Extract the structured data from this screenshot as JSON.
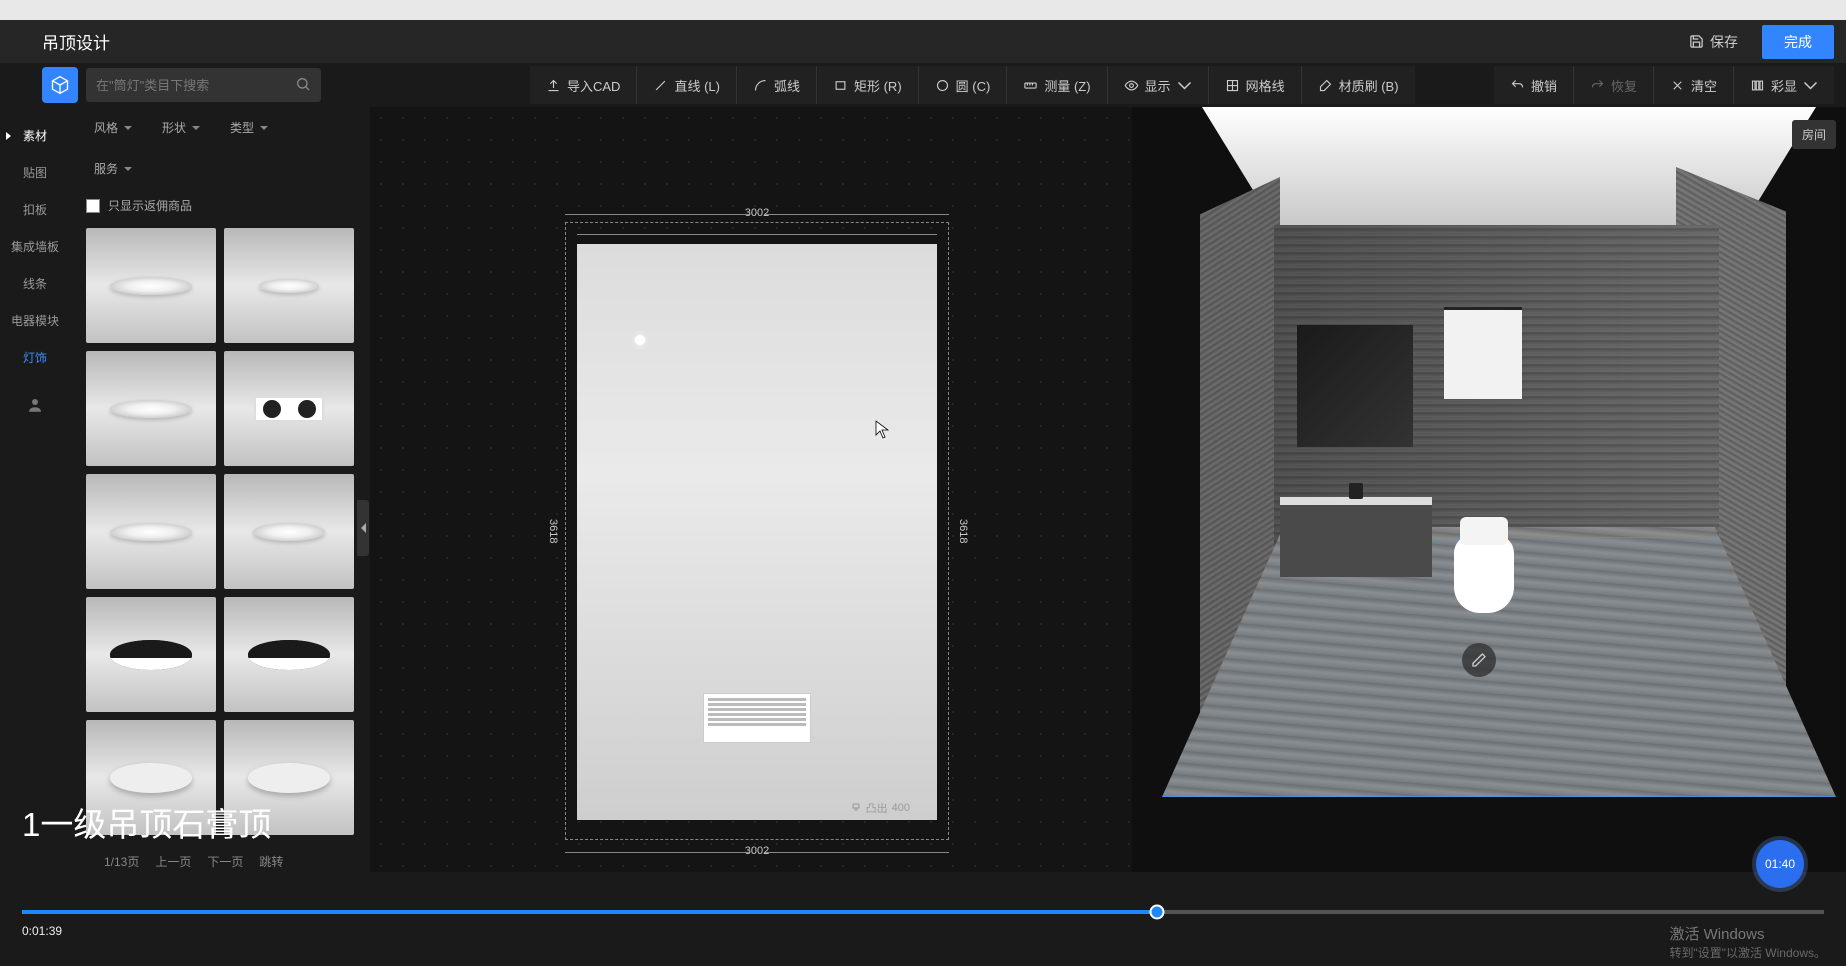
{
  "header": {
    "title": "吊顶设计",
    "save": "保存",
    "done": "完成"
  },
  "search": {
    "placeholder": "在\"筒灯\"类目下搜索"
  },
  "toolbar": {
    "import_cad": "导入CAD",
    "line": "直线 (L)",
    "arc": "弧线",
    "rect": "矩形 (R)",
    "circle": "圆 (C)",
    "measure": "测量 (Z)",
    "display": "显示",
    "grid": "网格线",
    "material": "材质刷 (B)",
    "undo": "撤销",
    "redo": "恢复",
    "clear": "清空",
    "color": "彩显"
  },
  "sidebar": {
    "tabs": [
      "素材",
      "贴图",
      "扣板",
      "集成墙板",
      "线条",
      "电器模块",
      "灯饰"
    ]
  },
  "filters": {
    "style": "风格",
    "shape": "形状",
    "type": "类型",
    "service": "服务",
    "checkbox": "只显示返佣商品"
  },
  "pagination": {
    "page_of": "1/13页",
    "prev": "上一页",
    "next": "下一页",
    "jump": "跳转"
  },
  "canvas": {
    "dim_w": "3002",
    "dim_h": "3618",
    "elev_label": "凸出",
    "elev_value": "400"
  },
  "viewport": {
    "room_btn": "房间"
  },
  "caption": "1一级吊顶石膏顶",
  "video": {
    "time": "0:01:39",
    "bubble": "01:40"
  },
  "watermark": {
    "line1": "激活 Windows",
    "line2": "转到\"设置\"以激活 Windows。"
  }
}
